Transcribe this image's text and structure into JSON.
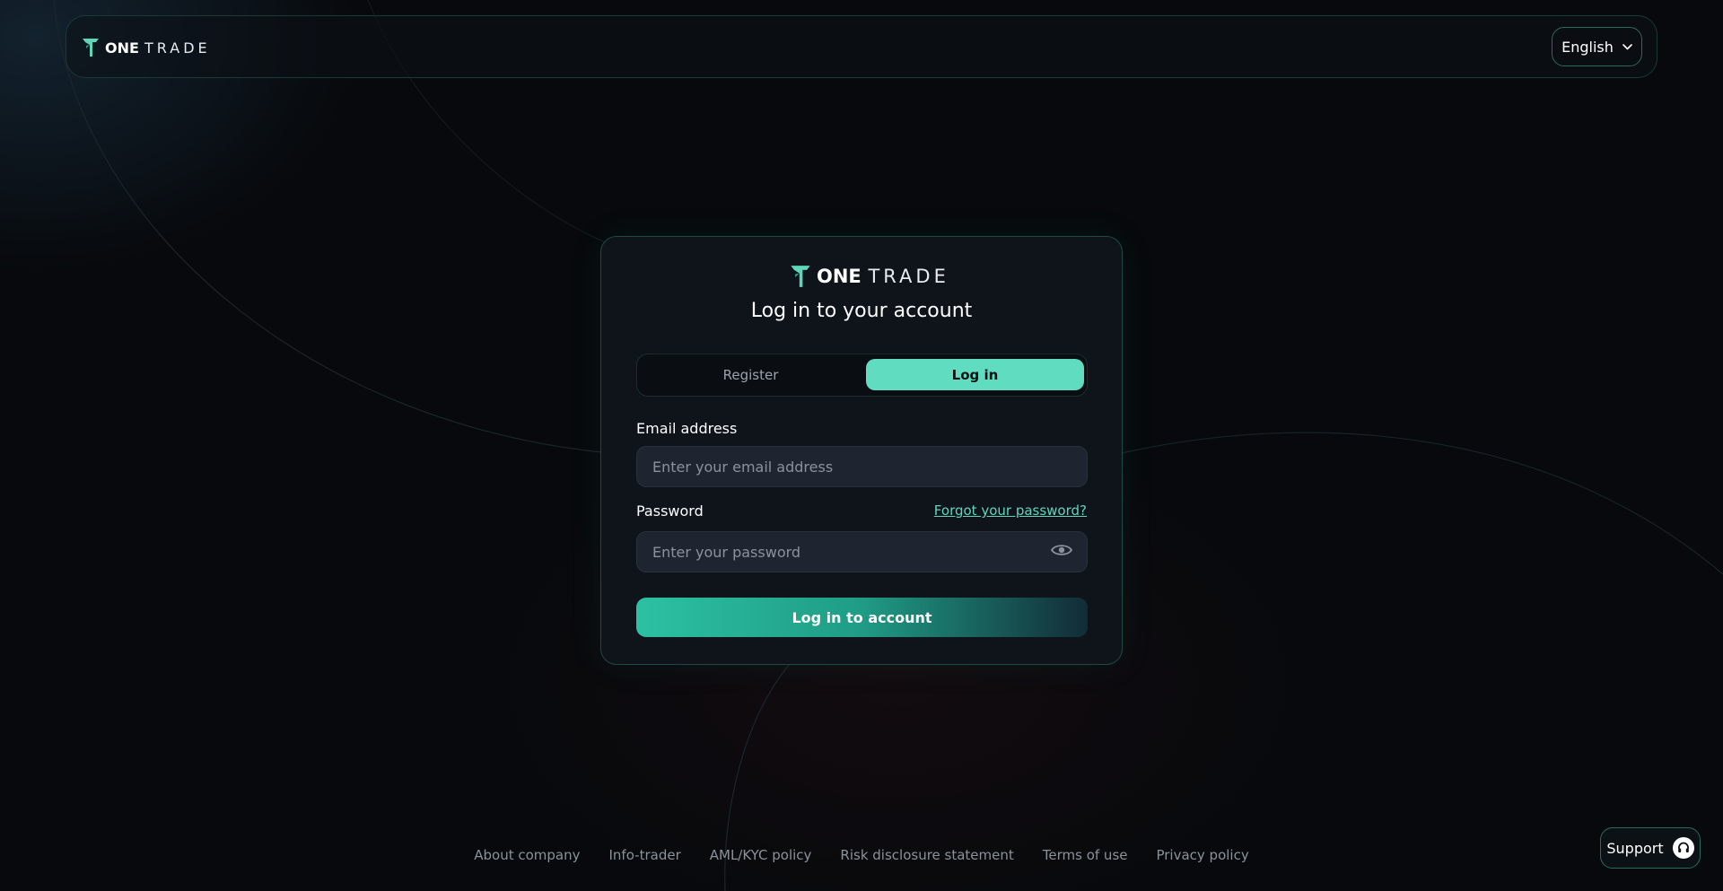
{
  "brand": {
    "name_bold": "ONE",
    "name_light": "TRADE"
  },
  "header": {
    "language": "English"
  },
  "login_card": {
    "title": "Log in to your account",
    "tabs": [
      {
        "label": "Register",
        "active": false
      },
      {
        "label": "Log in",
        "active": true
      }
    ],
    "email": {
      "label": "Email address",
      "placeholder": "Enter your email address",
      "value": ""
    },
    "password": {
      "label": "Password",
      "placeholder": "Enter your password",
      "value": "",
      "forgot_label": "Forgot your password?"
    },
    "submit_label": "Log in to account"
  },
  "footer": {
    "links": [
      "About company",
      "Info-trader",
      "AML/KYC policy",
      "Risk disclosure statement",
      "Terms of use",
      "Privacy policy"
    ]
  },
  "support": {
    "label": "Support",
    "icon": "headset-icon"
  },
  "colors": {
    "accent": "#60dcc0",
    "background": "#07090c",
    "card": "#0f141b",
    "input": "#1f2530"
  }
}
